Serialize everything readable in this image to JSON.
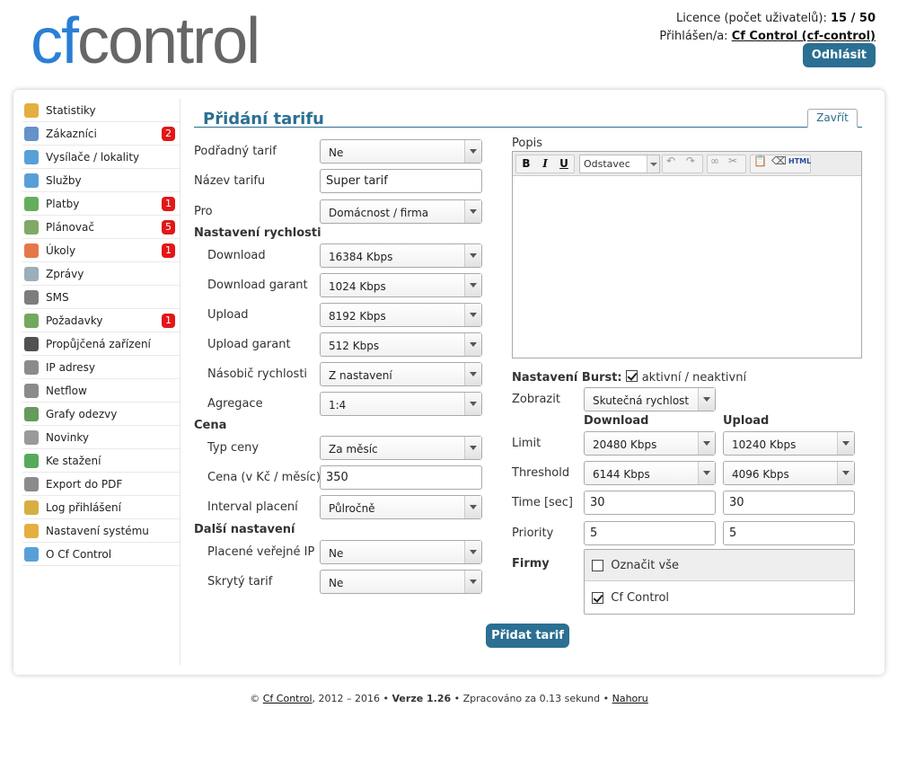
{
  "header": {
    "logo_cf": "cf",
    "logo_rest": "control",
    "licence_label": "Licence (počet uživatelů):",
    "licence_value": "15 / 50",
    "logged_label": "Přihlášen/a:",
    "logged_user": "Cf Control (cf-control)",
    "logout": "Odhlásit"
  },
  "sidebar": {
    "items": [
      {
        "label": "Statistiky",
        "icon": "chart-icon"
      },
      {
        "label": "Zákazníci",
        "icon": "users-icon",
        "badge": "2"
      },
      {
        "label": "Vysílače / lokality",
        "icon": "antenna-icon"
      },
      {
        "label": "Služby",
        "icon": "cloud-icon"
      },
      {
        "label": "Platby",
        "icon": "money-icon",
        "badge": "1"
      },
      {
        "label": "Plánovač",
        "icon": "calendar-icon",
        "badge": "5"
      },
      {
        "label": "Úkoly",
        "icon": "lifebuoy-icon",
        "badge": "1"
      },
      {
        "label": "Zprávy",
        "icon": "mail-icon"
      },
      {
        "label": "SMS",
        "icon": "phone-icon"
      },
      {
        "label": "Požadavky",
        "icon": "list-icon",
        "badge": "1"
      },
      {
        "label": "Propůjčená zařízení",
        "icon": "device-icon"
      },
      {
        "label": "IP adresy",
        "icon": "ip-icon"
      },
      {
        "label": "Netflow",
        "icon": "netflow-icon"
      },
      {
        "label": "Grafy odezvy",
        "icon": "graph-icon"
      },
      {
        "label": "Novinky",
        "icon": "news-icon"
      },
      {
        "label": "Ke stažení",
        "icon": "download-icon"
      },
      {
        "label": "Export do PDF",
        "icon": "pdf-icon"
      },
      {
        "label": "Log přihlášení",
        "icon": "key-icon"
      },
      {
        "label": "Nastavení systému",
        "icon": "gear-icon"
      },
      {
        "label": "O Cf Control",
        "icon": "info-icon"
      }
    ]
  },
  "form": {
    "title": "Přidání tarifu",
    "close": "Zavřít",
    "podradny_label": "Podřadný tarif",
    "podradny_value": "Ne",
    "nazev_label": "Název tarifu",
    "nazev_value": "Super tarif",
    "pro_label": "Pro",
    "pro_value": "Domácnost / firma",
    "speed_section": "Nastavení rychlosti",
    "download_label": "Download",
    "download_value": "16384 Kbps",
    "download_g_label": "Download garant",
    "download_g_value": "1024 Kbps",
    "upload_label": "Upload",
    "upload_value": "8192 Kbps",
    "upload_g_label": "Upload garant",
    "upload_g_value": "512 Kbps",
    "nasobic_label": "Násobič rychlosti",
    "nasobic_value": "Z nastavení",
    "agregace_label": "Agregace",
    "agregace_value": "1:4",
    "cena_section": "Cena",
    "typ_label": "Typ ceny",
    "typ_value": "Za měsíc",
    "cena_label": "Cena (v Kč / měsíc)",
    "cena_value": "350",
    "interval_label": "Interval placení",
    "interval_value": "Půlročně",
    "dalsi_section": "Další nastavení",
    "ip_label": "Placené veřejné IP",
    "ip_value": "Ne",
    "skryty_label": "Skrytý tarif",
    "skryty_value": "Ne",
    "popis_label": "Popis",
    "editor": {
      "bold": "B",
      "italic": "I",
      "underline": "U",
      "format": "Odstavec",
      "html": "HTML"
    },
    "burst_label": "Nastavení Burst:",
    "burst_toggle": "aktivní / neaktivní",
    "zobrazit_label": "Zobrazit",
    "zobrazit_value": "Skutečná rychlost",
    "col_download": "Download",
    "col_upload": "Upload",
    "limit_label": "Limit",
    "limit_down": "20480 Kbps",
    "limit_up": "10240 Kbps",
    "threshold_label": "Threshold",
    "threshold_down": "6144 Kbps",
    "threshold_up": "4096 Kbps",
    "time_label": "Time [sec]",
    "time_down": "30",
    "time_up": "30",
    "priority_label": "Priority",
    "priority_down": "5",
    "priority_up": "5",
    "firmy_label": "Firmy",
    "select_all": "Označit vše",
    "firm1": "Cf Control",
    "submit": "Přidat tarif"
  },
  "footer": {
    "copy": "©",
    "brand": "Cf Control",
    "years": ", 2012 – 2016 •",
    "version": "Verze 1.26",
    "processed": "• Zpracováno za 0.13 sekund •",
    "top": "Nahoru"
  }
}
